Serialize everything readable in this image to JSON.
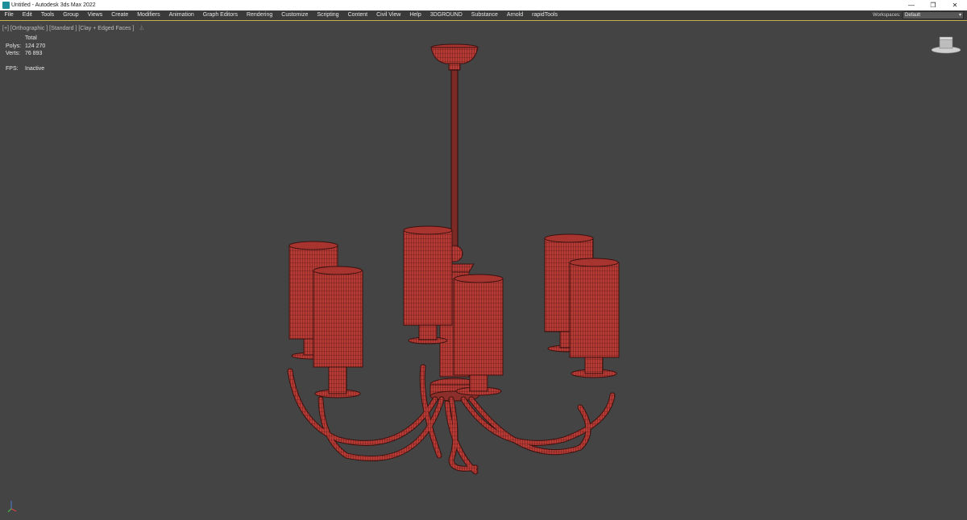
{
  "window": {
    "title": "Untitled - Autodesk 3ds Max 2022",
    "controls": {
      "minimize": "—",
      "restore": "❐",
      "close": "✕"
    }
  },
  "menubar": {
    "items": [
      "File",
      "Edit",
      "Tools",
      "Group",
      "Views",
      "Create",
      "Modifiers",
      "Animation",
      "Graph Editors",
      "Rendering",
      "Customize",
      "Scripting",
      "Content",
      "Civil View",
      "Help",
      "3DGROUND",
      "Substance",
      "Arnold",
      "rapidTools"
    ],
    "workspace_label": "Workspaces:",
    "workspace_value": "Default"
  },
  "viewport": {
    "label": "[+] [Orthographic ] [Standard ] [Clay + Edged Faces ]",
    "stats": {
      "header": "Total",
      "polys_label": "Polys:",
      "polys_value": "124 270",
      "verts_label": "Verts:",
      "verts_value": "76 893",
      "fps_label": "FPS:",
      "fps_value": "Inactive"
    },
    "border_color": "#c9b24a",
    "background": "#444444"
  },
  "model": {
    "description_icon": "chandelier-wireframe",
    "fill_color": "#b83a34",
    "wire_color": "#3a1210"
  },
  "icons": [
    "app-3dsmax-icon",
    "filter-icon",
    "viewcube-icon",
    "axis-tripod-icon"
  ]
}
